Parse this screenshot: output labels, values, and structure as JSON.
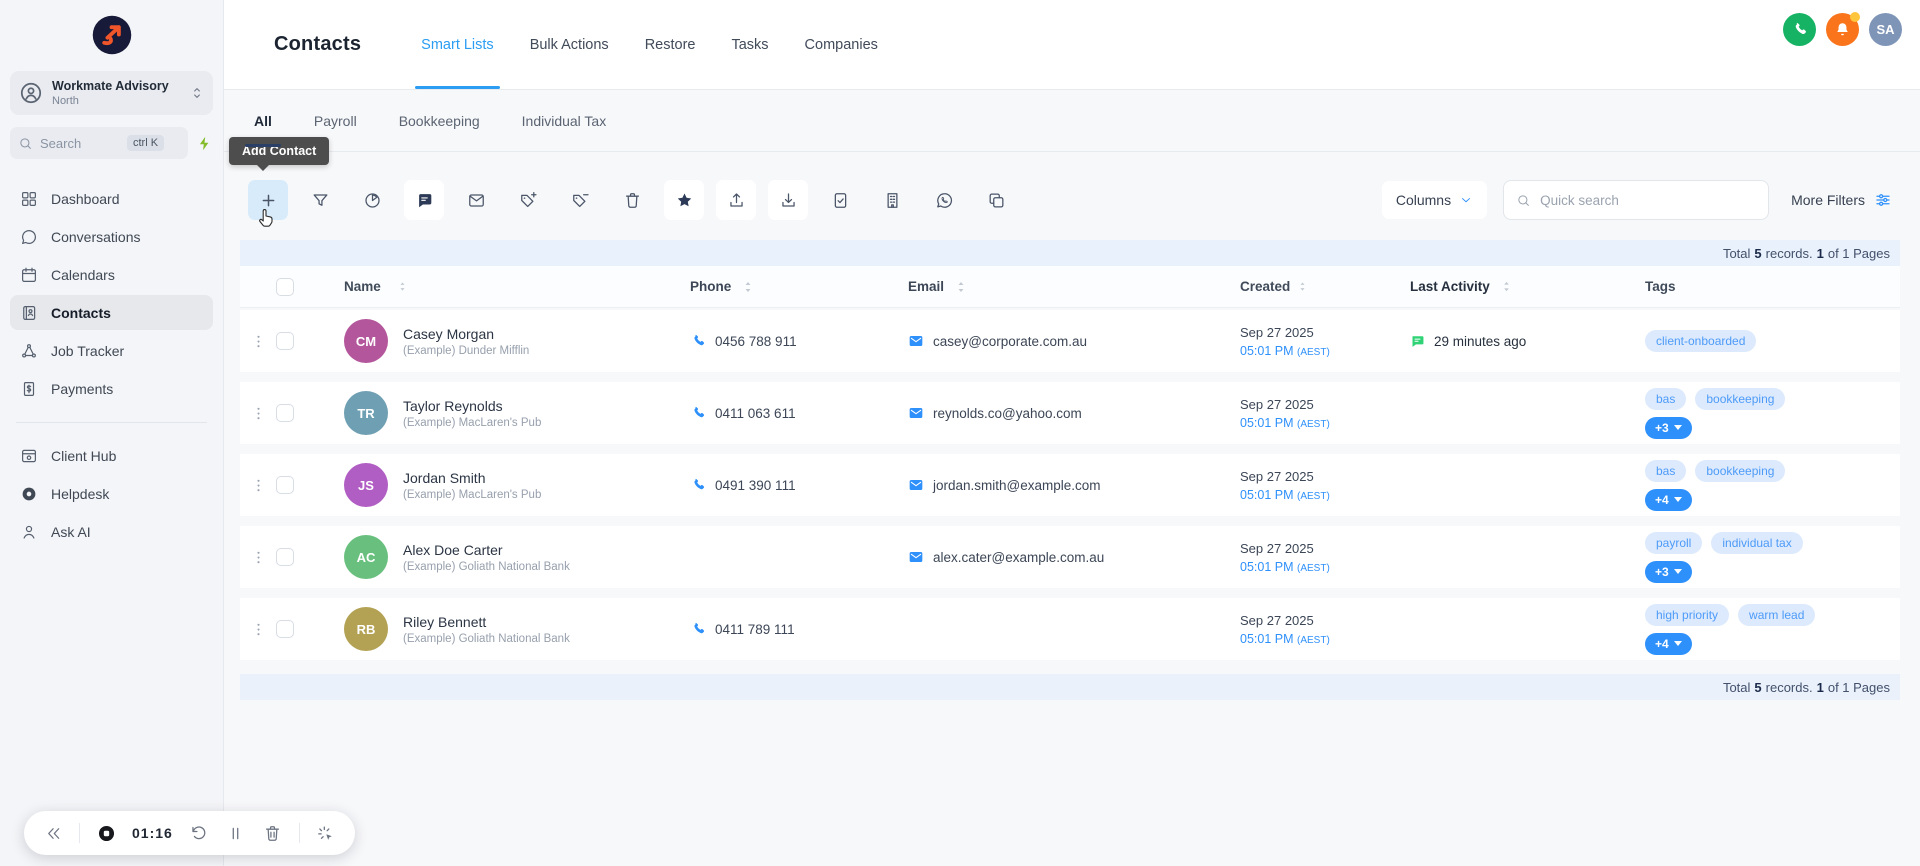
{
  "colors": {
    "accent_blue": "#2e90fa",
    "tab_blue": "#2b9df3",
    "subtab_underline": "#2a3f66",
    "tag_bg": "#ddeafd",
    "tag_text": "#4d9bf8",
    "call_green": "#16b364",
    "notification_orange": "#f9741b",
    "activity_green": "#2fd375",
    "logo_navy": "#171a38",
    "logo_orange": "#f1552a"
  },
  "sidebar": {
    "workspace_name": "Workmate Advisory",
    "workspace_location": "North",
    "search_placeholder": "Search",
    "search_shortcut": "ctrl K",
    "nav_items": [
      {
        "label": "Dashboard",
        "icon": "dashboard-icon",
        "active": false
      },
      {
        "label": "Conversations",
        "icon": "conversations-icon",
        "active": false
      },
      {
        "label": "Calendars",
        "icon": "calendars-icon",
        "active": false
      },
      {
        "label": "Contacts",
        "icon": "contacts-icon",
        "active": true
      },
      {
        "label": "Job Tracker",
        "icon": "job-tracker-icon",
        "active": false
      },
      {
        "label": "Payments",
        "icon": "payments-icon",
        "active": false
      }
    ],
    "secondary_items": [
      {
        "label": "Client Hub",
        "icon": "client-hub-icon",
        "active": false
      },
      {
        "label": "Helpdesk",
        "icon": "helpdesk-icon",
        "active": false
      },
      {
        "label": "Ask AI",
        "icon": "ask-ai-icon",
        "active": false
      }
    ]
  },
  "header": {
    "title": "Contacts",
    "tabs": [
      {
        "label": "Smart Lists",
        "active": true
      },
      {
        "label": "Bulk Actions",
        "active": false
      },
      {
        "label": "Restore",
        "active": false
      },
      {
        "label": "Tasks",
        "active": false
      },
      {
        "label": "Companies",
        "active": false
      }
    ],
    "actions": [
      {
        "name": "call-icon",
        "color": "#16b364"
      },
      {
        "name": "notifications-bell-icon",
        "color": "#f9741b",
        "has_dot": true
      }
    ],
    "avatar_initials": "SA"
  },
  "subtabs": [
    {
      "label": "All",
      "active": true
    },
    {
      "label": "Payroll",
      "active": false
    },
    {
      "label": "Bookkeeping",
      "active": false
    },
    {
      "label": "Individual Tax",
      "active": false
    }
  ],
  "tooltip": {
    "text": "Add Contact"
  },
  "toolbar": {
    "icons": [
      {
        "name": "add-contact-icon",
        "style": "active"
      },
      {
        "name": "filter-icon",
        "style": "plain"
      },
      {
        "name": "campaign-icon",
        "style": "plain"
      },
      {
        "name": "sms-icon",
        "style": "card"
      },
      {
        "name": "email-icon",
        "style": "plain"
      },
      {
        "name": "add-tag-icon",
        "style": "plain"
      },
      {
        "name": "remove-tag-icon",
        "style": "plain"
      },
      {
        "name": "delete-icon",
        "style": "plain"
      },
      {
        "name": "star-icon",
        "style": "card"
      },
      {
        "name": "export-icon",
        "style": "card"
      },
      {
        "name": "import-icon",
        "style": "card"
      },
      {
        "name": "merge-icon",
        "style": "plain"
      },
      {
        "name": "company-icon",
        "style": "plain"
      },
      {
        "name": "whatsapp-icon",
        "style": "plain"
      },
      {
        "name": "copy-icon",
        "style": "plain"
      }
    ],
    "columns_label": "Columns",
    "quick_search_placeholder": "Quick search",
    "more_filters_label": "More Filters"
  },
  "summary": {
    "total_label": "Total",
    "record_count": "5",
    "records_label": "records.",
    "current_page": "1",
    "pages_label": "of 1 Pages"
  },
  "table": {
    "headers": [
      {
        "label": "Name",
        "sortable": true
      },
      {
        "label": "Phone",
        "sortable": true
      },
      {
        "label": "Email",
        "sortable": true
      },
      {
        "label": "Created",
        "sortable": true
      },
      {
        "label": "Last Activity",
        "sortable": true
      },
      {
        "label": "Tags",
        "sortable": false
      }
    ],
    "rows": [
      {
        "initials": "CM",
        "avatar_color": "#b4569b",
        "name": "Casey Morgan",
        "company": "(Example) Dunder Mifflin",
        "phone": "0456 788 911",
        "email": "casey@corporate.com.au",
        "created_date": "Sep 27 2025",
        "created_time": "05:01 PM",
        "created_tz": "(AEST)",
        "last_activity": "29 minutes ago",
        "tags": [
          "client-onboarded"
        ],
        "more_tags": ""
      },
      {
        "initials": "TR",
        "avatar_color": "#6f9fb2",
        "name": "Taylor Reynolds",
        "company": "(Example) MacLaren's Pub",
        "phone": "0411 063 611",
        "email": "reynolds.co@yahoo.com",
        "created_date": "Sep 27 2025",
        "created_time": "05:01 PM",
        "created_tz": "(AEST)",
        "last_activity": "",
        "tags": [
          "bas",
          "bookkeeping"
        ],
        "more_tags": "+3"
      },
      {
        "initials": "JS",
        "avatar_color": "#b05ec4",
        "name": "Jordan Smith",
        "company": "(Example) MacLaren's Pub",
        "phone": "0491 390 111",
        "email": "jordan.smith@example.com",
        "created_date": "Sep 27 2025",
        "created_time": "05:01 PM",
        "created_tz": "(AEST)",
        "last_activity": "",
        "tags": [
          "bas",
          "bookkeeping"
        ],
        "more_tags": "+4"
      },
      {
        "initials": "AC",
        "avatar_color": "#69c07e",
        "name": "Alex Doe Carter",
        "company": "(Example) Goliath National Bank",
        "phone": "",
        "email": "alex.cater@example.com.au",
        "created_date": "Sep 27 2025",
        "created_time": "05:01 PM",
        "created_tz": "(AEST)",
        "last_activity": "",
        "tags": [
          "payroll",
          "individual tax"
        ],
        "more_tags": "+3"
      },
      {
        "initials": "RB",
        "avatar_color": "#b3a254",
        "name": "Riley Bennett",
        "company": "(Example) Goliath National Bank",
        "phone": "0411 789 111",
        "email": "",
        "created_date": "Sep 27 2025",
        "created_time": "05:01 PM",
        "created_tz": "(AEST)",
        "last_activity": "",
        "tags": [
          "high priority",
          "warm lead"
        ],
        "more_tags": "+4"
      }
    ]
  },
  "recorder": {
    "time": "01:16",
    "buttons_left": [
      {
        "name": "collapse-icon"
      }
    ],
    "buttons_mid": [
      {
        "name": "restart-icon"
      },
      {
        "name": "pause-icon"
      },
      {
        "name": "delete-icon"
      }
    ],
    "buttons_right": [
      {
        "name": "magic-cursor-icon"
      }
    ]
  }
}
